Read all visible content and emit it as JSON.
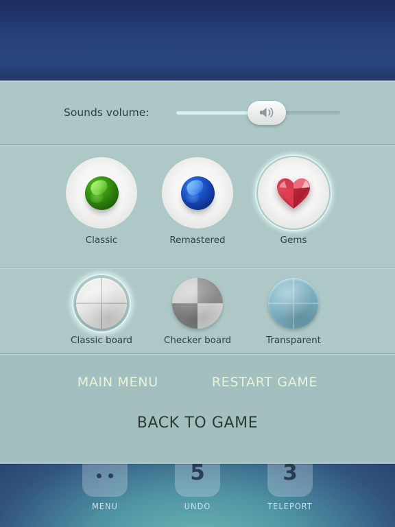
{
  "screen": {
    "title": "Game Settings Overlay",
    "panel_bg": "#aec8c7",
    "accent_link": "#e7f4d8",
    "text_dark": "#2f3f44"
  },
  "volume": {
    "label": "Sounds volume:",
    "icon": "speaker-icon",
    "value_percent": 50,
    "fill_color": "#d5f0ef",
    "track_color": "#9cb8b8"
  },
  "marble_styles": {
    "section_name": "marble-style-options",
    "options": [
      {
        "label": "Classic",
        "icon": "green-marble-icon",
        "selected": false
      },
      {
        "label": "Remastered",
        "icon": "blue-marble-icon",
        "selected": false
      },
      {
        "label": "Gems",
        "icon": "red-heart-gem-icon",
        "selected": true
      }
    ]
  },
  "board_styles": {
    "section_name": "board-style-options",
    "options": [
      {
        "label": "Classic board",
        "icon": "plain-board-icon",
        "selected": true
      },
      {
        "label": "Checker board",
        "icon": "checker-board-icon",
        "selected": false
      },
      {
        "label": "Transparent",
        "icon": "transparent-board-icon",
        "selected": false
      }
    ]
  },
  "actions": {
    "main_menu": "MAIN MENU",
    "restart_game": "RESTART GAME",
    "back_to_game": "BACK TO GAME"
  },
  "toolbar": {
    "items": [
      {
        "label": "MENU",
        "icon": "menu-dots-icon",
        "count": ""
      },
      {
        "label": "UNDO",
        "icon": "undo-icon",
        "count": "5"
      },
      {
        "label": "TELEPORT",
        "icon": "teleport-icon",
        "count": "3"
      }
    ]
  }
}
